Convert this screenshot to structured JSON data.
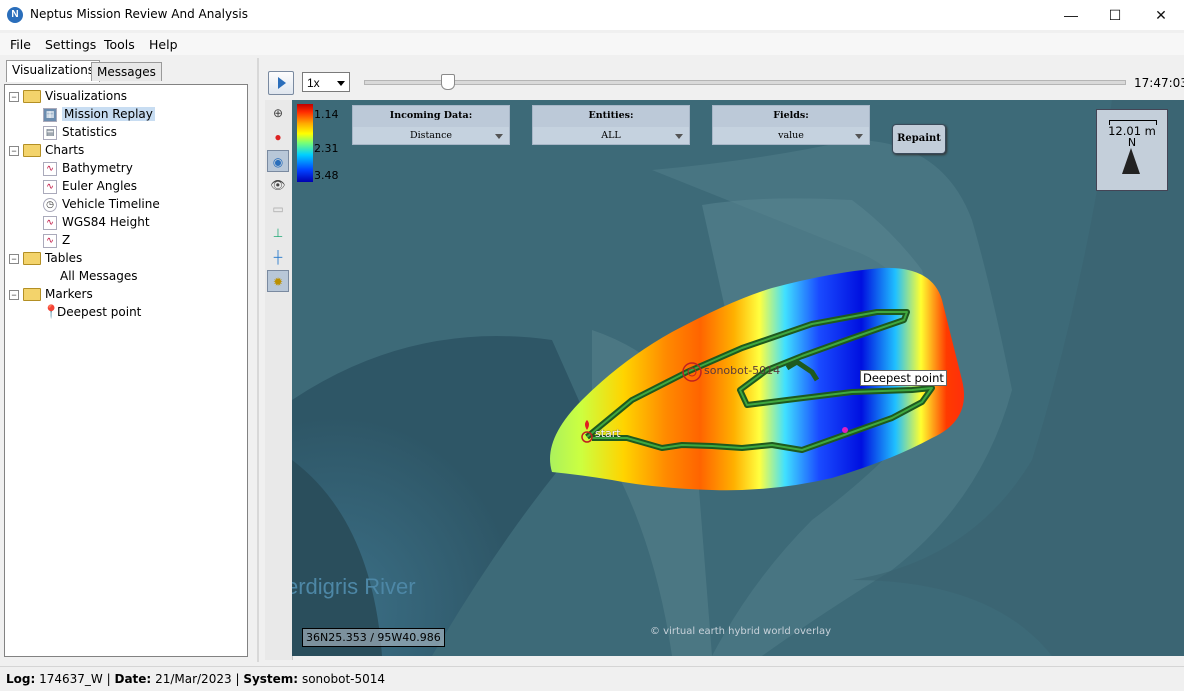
{
  "window": {
    "title": "Neptus Mission Review And Analysis",
    "minimize": "—",
    "maximize": "☐",
    "close": "✕"
  },
  "menu": [
    "File",
    "Settings",
    "Tools",
    "Help"
  ],
  "tabs": [
    "Visualizations",
    "Messages"
  ],
  "tree": {
    "visualizations": {
      "label": "Visualizations",
      "items": [
        "Mission Replay",
        "Statistics"
      ]
    },
    "charts": {
      "label": "Charts",
      "items": [
        "Bathymetry",
        "Euler Angles",
        "Vehicle Timeline",
        "WGS84 Height",
        "Z"
      ]
    },
    "tables": {
      "label": "Tables",
      "items": [
        "All Messages"
      ]
    },
    "markers": {
      "label": "Markers",
      "items": [
        "Deepest point"
      ]
    }
  },
  "playback": {
    "speed": "1x",
    "time": "17:47:03",
    "progress": 0.11
  },
  "legend": {
    "labels": [
      "1.14",
      "2.31",
      "3.48"
    ]
  },
  "controls": {
    "incoming": {
      "title": "Incoming Data:",
      "value": "Distance"
    },
    "entities": {
      "title": "Entities:",
      "value": "ALL"
    },
    "fields": {
      "title": "Fields:",
      "value": "value"
    },
    "repaint": "Repaint"
  },
  "scale": {
    "label": "12.01 m",
    "north": "N"
  },
  "map": {
    "coordinates": "36N25.353 / 95W40.986",
    "river_label": "erdigris River",
    "credit": "© virtual earth hybrid world overlay",
    "start_label": "start",
    "vehicle_label": "sonobot-5014",
    "marker_label": "Deepest point"
  },
  "status": {
    "log_label": "Log:",
    "log": "174637_W",
    "date_label": "Date:",
    "date": "21/Mar/2023",
    "system_label": "System:",
    "system": "sonobot-5014",
    "sep": "|"
  }
}
